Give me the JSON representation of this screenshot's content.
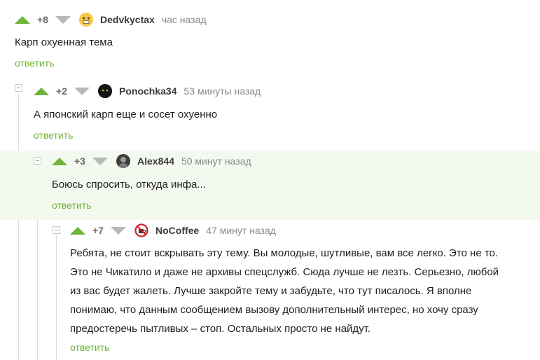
{
  "comments": [
    {
      "rating": "+8",
      "author": "Dedvkyctax",
      "time": "час назад",
      "text": "Карп охуенная тема",
      "reply": "ответить",
      "avatar": "yellow-emoji-icon"
    },
    {
      "rating": "+2",
      "author": "Ponochka34",
      "time": "53 минуты назад",
      "text": "А японский карп еще и сосет охуенно",
      "reply": "ответить",
      "avatar": "black-cat-icon"
    },
    {
      "rating": "+3",
      "author": "Alex844",
      "time": "50 минут назад",
      "text": "Боюсь спросить, откуда инфа...",
      "reply": "ответить",
      "avatar": "grey-photo-icon"
    },
    {
      "rating": "+7",
      "author": "NoCoffee",
      "time": "47 минут назад",
      "text_lines": [
        "Ребята, не стоит вскрывать эту тему. Вы молодые, шутливые, вам все легко. Это не то.",
        "Это не Чикатило и даже не архивы спецслужб. Сюда лучше не лезть. Серьезно, любой",
        "из вас будет жалеть. Лучше закройте тему и забудьте, что тут писалось. Я вполне",
        "понимаю, что данным сообщением вызову дополнительный интерес, но хочу сразу",
        "предостеречь пытливых – стоп. Остальных просто не найдут."
      ],
      "reply": "ответить",
      "avatar": "no-coffee-icon"
    }
  ],
  "colors": {
    "upvote": "#6cb43a",
    "downvote": "#b8b8b8",
    "reply": "#6cb43a",
    "highlight_bg": "#f4f9ef"
  }
}
